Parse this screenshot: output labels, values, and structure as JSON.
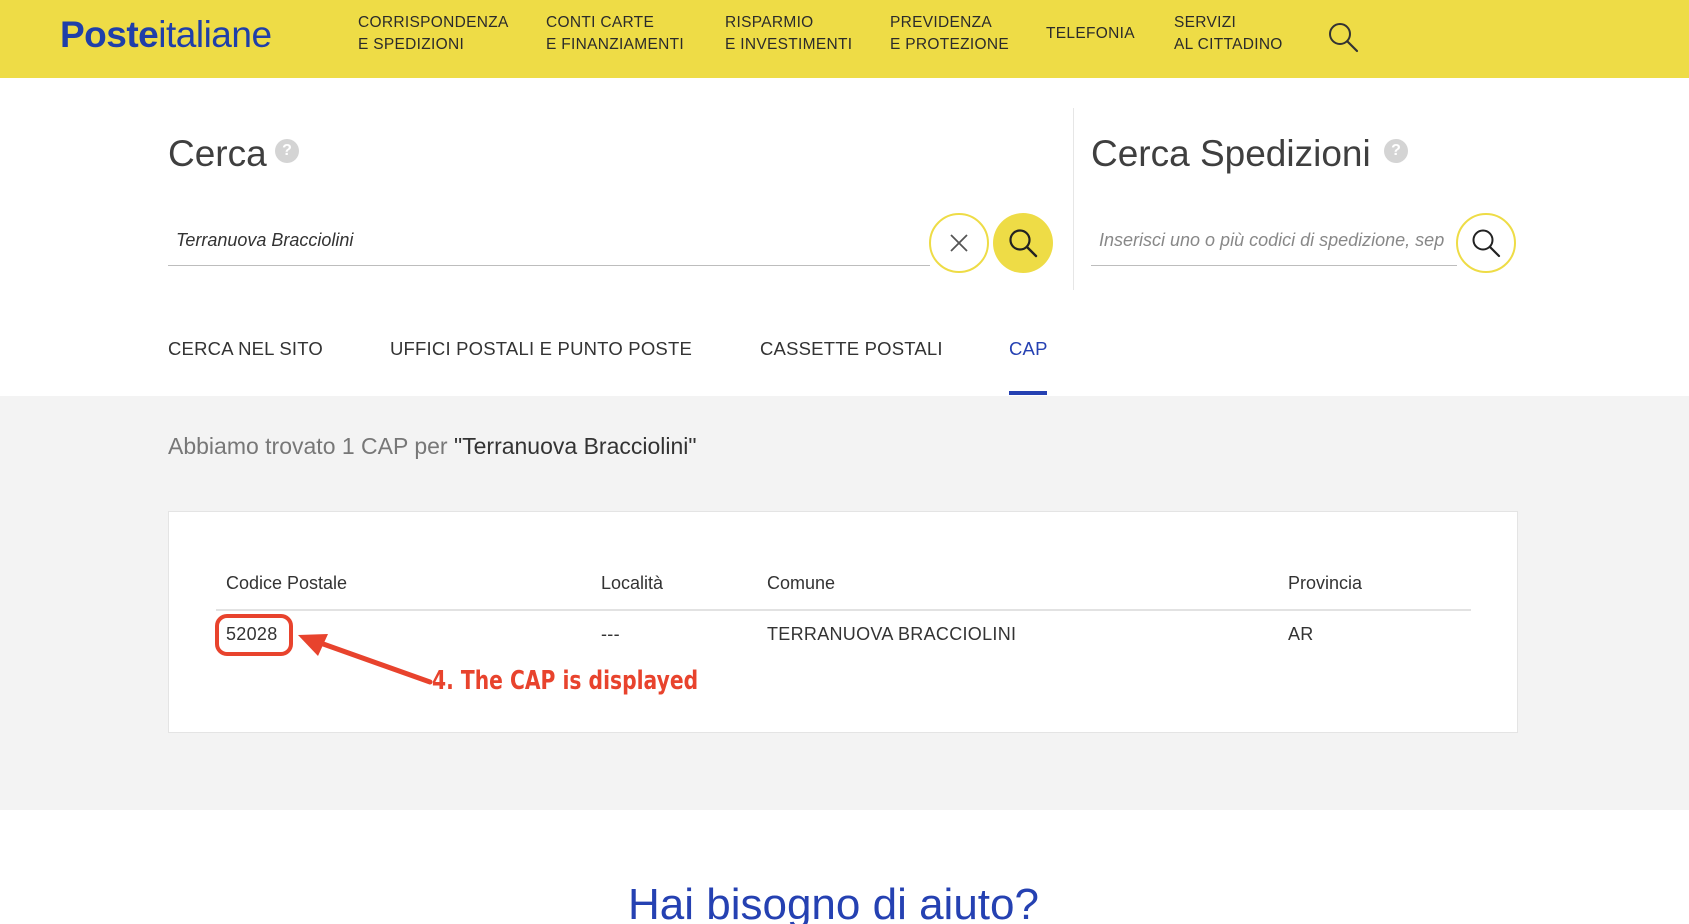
{
  "header": {
    "logo_bold": "Poste",
    "logo_regular": "italiane",
    "nav": [
      {
        "line1": "CORRISPONDENZA",
        "line2": "E SPEDIZIONI"
      },
      {
        "line1": "CONTI CARTE",
        "line2": "E FINANZIAMENTI"
      },
      {
        "line1": "RISPARMIO",
        "line2": "E INVESTIMENTI"
      },
      {
        "line1": "PREVIDENZA",
        "line2": "E PROTEZIONE"
      },
      {
        "line1": "TELEFONIA",
        "line2": ""
      },
      {
        "line1": "SERVIZI",
        "line2": "AL CITTADINO"
      }
    ],
    "search_icon": "search-icon"
  },
  "search": {
    "title": "Cerca",
    "help": "?",
    "value": "Terranuova Bracciolini",
    "clear_icon": "close-icon",
    "submit_icon": "search-icon"
  },
  "shipments": {
    "title": "Cerca Spedizioni",
    "help": "?",
    "placeholder": "Inserisci uno o più codici di spedizione, sep",
    "submit_icon": "search-icon"
  },
  "tabs": [
    {
      "label": "CERCA NEL SITO"
    },
    {
      "label": "UFFICI POSTALI E PUNTO POSTE"
    },
    {
      "label": "CASSETTE POSTALI"
    },
    {
      "label": "CAP",
      "active": true
    }
  ],
  "results": {
    "summary": "Abbiamo trovato 1 CAP per",
    "query": "\"Terranuova Bracciolini\"",
    "columns": [
      "Codice Postale",
      "Località",
      "Comune",
      "Provincia"
    ],
    "rows": [
      {
        "cap": "52028",
        "localita": "---",
        "comune": "TERRANUOVA BRACCIOLINI",
        "provincia": "AR"
      }
    ]
  },
  "annotation": {
    "text": "4.  The CAP is displayed",
    "color": "#e8432d"
  },
  "help_section": {
    "heading": "Hai bisogno di aiuto?"
  },
  "colors": {
    "brand_yellow": "#eedc46",
    "brand_blue": "#2541b2",
    "annotation_red": "#e8432d"
  }
}
